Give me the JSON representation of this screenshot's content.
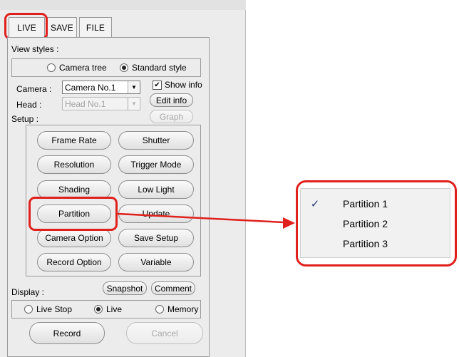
{
  "tabs": [
    {
      "label": "LIVE",
      "active": true
    },
    {
      "label": "SAVE",
      "active": false
    },
    {
      "label": "FILE",
      "active": false
    }
  ],
  "view_styles": {
    "label": "View styles :",
    "options": [
      {
        "label": "Camera tree",
        "selected": false
      },
      {
        "label": "Standard style",
        "selected": true
      }
    ]
  },
  "camera": {
    "camera_label": "Camera :",
    "camera_value": "Camera No.1",
    "head_label": "Head :",
    "head_value": "Head No.1",
    "show_info_label": "Show info",
    "show_info_checked": true,
    "edit_info_label": "Edit info",
    "graph_label": "Graph"
  },
  "setup": {
    "label": "Setup :",
    "buttons": [
      "Frame Rate",
      "Shutter",
      "Resolution",
      "Trigger Mode",
      "Shading",
      "Low Light",
      "Partition",
      "Update",
      "Camera Option",
      "Save Setup",
      "Record Option",
      "Variable"
    ]
  },
  "display": {
    "label": "Display :",
    "snapshot_label": "Snapshot",
    "comment_label": "Comment",
    "options": [
      {
        "label": "Live Stop",
        "selected": false
      },
      {
        "label": "Live",
        "selected": true
      },
      {
        "label": "Memory",
        "selected": false
      }
    ],
    "record_label": "Record",
    "cancel_label": "Cancel"
  },
  "partition_menu": {
    "items": [
      {
        "label": "Partition  1",
        "checked": true
      },
      {
        "label": "Partition  2",
        "checked": false
      },
      {
        "label": "Partition  3",
        "checked": false
      }
    ],
    "check_glyph": "✓"
  },
  "colors": {
    "highlight": "#e0201c",
    "panel_bg": "#ececec"
  }
}
